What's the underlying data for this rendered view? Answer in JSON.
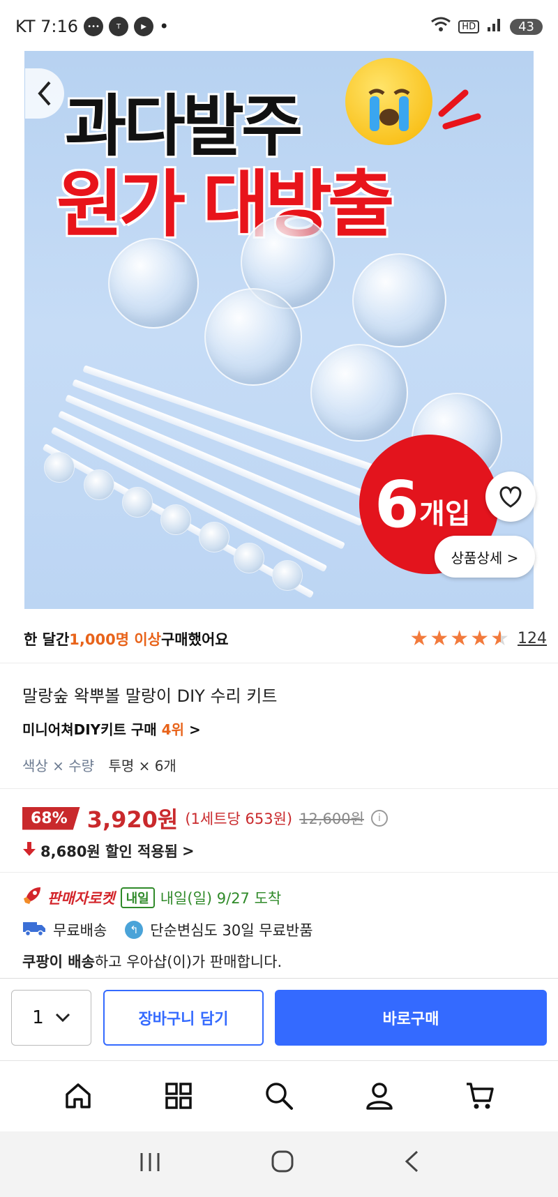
{
  "status_bar": {
    "carrier_time": "KT 7:16",
    "hd_label": "HD",
    "battery": "43"
  },
  "hero": {
    "headline_top": "과다발주",
    "headline_bottom": "원가 대방출",
    "badge_number": "6",
    "badge_unit": "개입",
    "detail_button": "상품상세 >"
  },
  "summary": {
    "sold_prefix": "한 달간 ",
    "sold_highlight": "1,000명 이상",
    "sold_suffix": " 구매했어요",
    "rating": 4.5,
    "review_count": "124"
  },
  "product": {
    "title": "말랑숲 왁뿌볼 말랑이 DIY 수리 키트",
    "category_prefix": "미니어쳐DIY키트 구매 ",
    "category_rank": "4위",
    "category_chevron": ">",
    "option_label": "색상 × 수량",
    "option_value": "투명 × 6개"
  },
  "pricing": {
    "discount_pct": "68%",
    "price": "3,920원",
    "unit_price": "(1세트당 653원)",
    "original_price": "12,600원",
    "info_icon_glyph": "i",
    "discount_applied": "8,680원 할인 적용됨",
    "chevron": ">"
  },
  "delivery": {
    "rocket_label": "판매자로켓",
    "tomorrow_tag": "내일",
    "arrival": "내일(일) 9/27 도착",
    "free_shipping": "무료배송",
    "free_return": "단순변심도 30일 무료반품",
    "seller_bold": "쿠팡이 배송",
    "seller_rest": "하고 우아샵(이)가 판매합니다."
  },
  "buy_bar": {
    "quantity": "1",
    "cart_button": "장바구니 담기",
    "buy_button": "바로구매"
  },
  "bottom_nav": {
    "items": [
      "home-icon",
      "category-icon",
      "search-icon",
      "my-account-icon",
      "cart-icon"
    ]
  },
  "colors": {
    "accent_blue": "#346aff",
    "sale_red": "#c9292c",
    "highlight_orange": "#e8631a",
    "rocket_green": "#2f8a29"
  }
}
